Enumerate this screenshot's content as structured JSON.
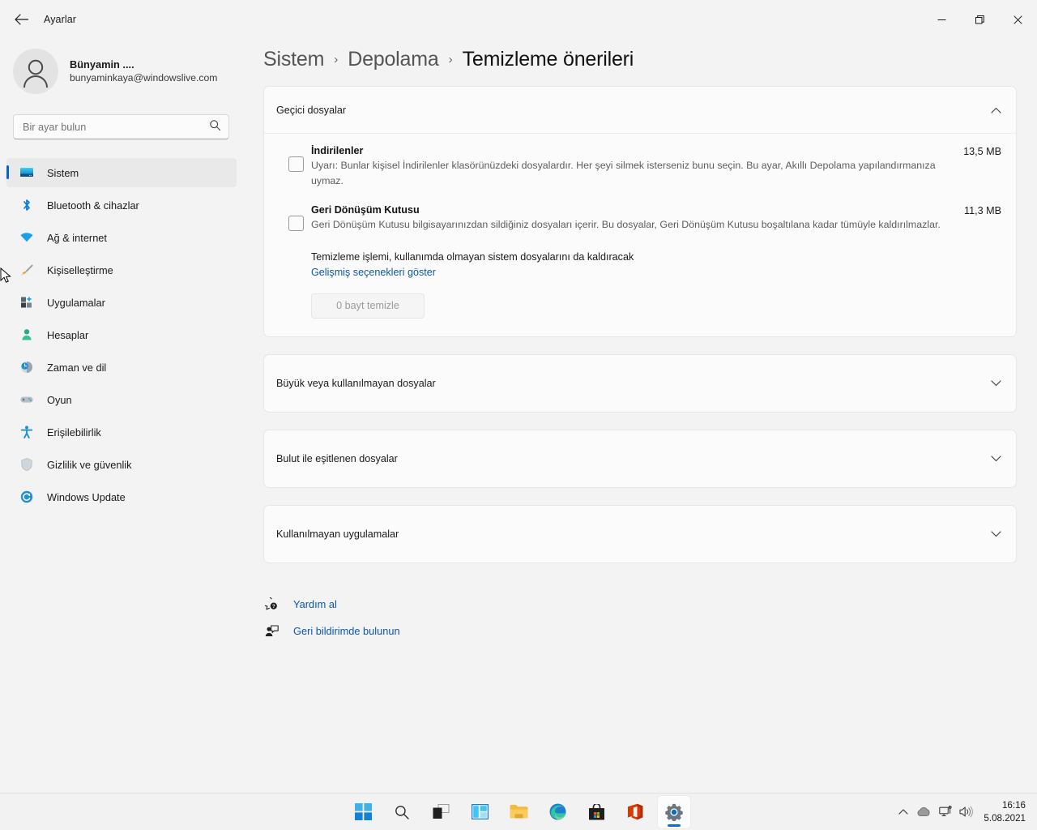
{
  "window": {
    "title": "Ayarlar",
    "back_icon": "back-arrow-icon",
    "minimize_label": "—",
    "maximize_label": "❐",
    "close_label": "×"
  },
  "account": {
    "name": "Bünyamin ....",
    "email": "bunyaminkaya@windowslive.com",
    "avatar_icon": "user-avatar-icon"
  },
  "search": {
    "placeholder": "Bir ayar bulun",
    "icon": "search-icon"
  },
  "sidebar": {
    "items": [
      {
        "label": "Sistem",
        "icon": "monitor-icon",
        "active": true
      },
      {
        "label": "Bluetooth & cihazlar",
        "icon": "bluetooth-icon",
        "active": false
      },
      {
        "label": "Ağ & internet",
        "icon": "wifi-icon",
        "active": false
      },
      {
        "label": "Kişiselleştirme",
        "icon": "paintbrush-icon",
        "active": false
      },
      {
        "label": "Uygulamalar",
        "icon": "apps-icon",
        "active": false
      },
      {
        "label": "Hesaplar",
        "icon": "person-icon",
        "active": false
      },
      {
        "label": "Zaman ve dil",
        "icon": "clock-globe-icon",
        "active": false
      },
      {
        "label": "Oyun",
        "icon": "gamepad-icon",
        "active": false
      },
      {
        "label": "Erişilebilirlik",
        "icon": "accessibility-icon",
        "active": false
      },
      {
        "label": "Gizlilik ve güvenlik",
        "icon": "shield-icon",
        "active": false
      },
      {
        "label": "Windows Update",
        "icon": "update-icon",
        "active": false
      }
    ]
  },
  "breadcrumb": {
    "items": [
      "Sistem",
      "Depolama",
      "Temizleme önerileri"
    ],
    "separator": "›"
  },
  "temp_files_card": {
    "title": "Geçici dosyalar",
    "expanded": true,
    "chevron_icon": "chevron-up-icon",
    "items": [
      {
        "name": "İndirilenler",
        "size": "13,5 MB",
        "description": "Uyarı: Bunlar kişisel İndirilenler klasörünüzdeki dosyalardır. Her şeyi silmek isterseniz bunu seçin. Bu ayar, Akıllı Depolama yapılandırmanıza uymaz.",
        "checked": false
      },
      {
        "name": "Geri Dönüşüm Kutusu",
        "size": "11,3 MB",
        "description": "Geri Dönüşüm Kutusu bilgisayarınızdan sildiğiniz dosyaları içerir. Bu dosyalar, Geri Dönüşüm Kutusu boşaltılana kadar tümüyle kaldırılmazlar.",
        "checked": false
      }
    ],
    "note": "Temizleme işlemi, kullanımda olmayan sistem dosyalarını da kaldıracak",
    "advanced_link": "Gelişmiş seçenekleri göster",
    "clean_button": "0 bayt temizle"
  },
  "collapsed_cards": [
    {
      "title": "Büyük veya kullanılmayan dosyalar",
      "chevron_icon": "chevron-down-icon"
    },
    {
      "title": "Bulut ile eşitlenen dosyalar",
      "chevron_icon": "chevron-down-icon"
    },
    {
      "title": "Kullanılmayan uygulamalar",
      "chevron_icon": "chevron-down-icon"
    }
  ],
  "footer_links": [
    {
      "label": "Yardım al",
      "icon": "help-question-icon"
    },
    {
      "label": "Geri bildirimde bulunun",
      "icon": "feedback-icon"
    }
  ],
  "taskbar": {
    "icons": [
      {
        "name": "start-icon",
        "active": false
      },
      {
        "name": "search-icon",
        "active": false
      },
      {
        "name": "task-view-icon",
        "active": false
      },
      {
        "name": "widgets-icon",
        "active": false
      },
      {
        "name": "file-explorer-icon",
        "active": false
      },
      {
        "name": "edge-icon",
        "active": false
      },
      {
        "name": "microsoft-store-icon",
        "active": false
      },
      {
        "name": "office-icon",
        "active": false
      },
      {
        "name": "settings-icon",
        "active": true
      }
    ],
    "tray": [
      {
        "name": "show-hidden-icons-icon"
      },
      {
        "name": "onedrive-cloud-icon"
      },
      {
        "name": "network-icon"
      },
      {
        "name": "volume-icon"
      }
    ],
    "clock": {
      "time": "16:16",
      "date": "5.08.2021"
    }
  },
  "colors": {
    "accent": "#0a64c8",
    "link": "#0b57ad",
    "page_bg": "#f3f3f3",
    "card_bg": "#fbfbfb"
  }
}
